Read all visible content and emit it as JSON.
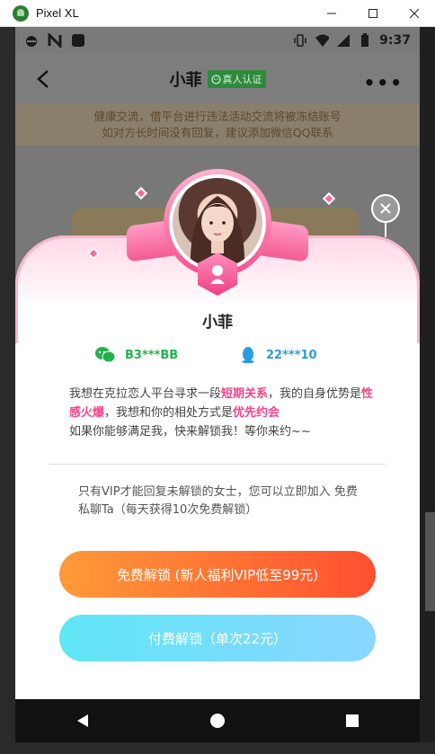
{
  "window": {
    "title": "Pixel XL"
  },
  "status_bar": {
    "time": "9:37"
  },
  "header": {
    "name": "小菲",
    "verified_label": "真人认证"
  },
  "notice": {
    "line1": "健康交流，借平台进行违法活动交流将被冻结账号",
    "line2": "如对方长时间没有回复，建议添加微信QQ联系"
  },
  "dialog": {
    "name": "小菲",
    "wechat": "B3***BB",
    "qq": "22***10",
    "intro": {
      "p1": "我想在克拉恋人平台寻求一段",
      "h1": "短期关系",
      "p2": "，我的自身优势是",
      "h2": "性感火爆",
      "p3": "，我想和你的相处方式是",
      "h3": "优先约会",
      "p4": "如果你能够满足我，快来解锁我！等你来约~~"
    },
    "vip_note": "只有VIP才能回复未解锁的女士，您可以立即加入 免费私聊Ta（每天获得10次免费解锁）",
    "free_unlock_label": "免费解锁 (新人福利VIP低至99元)",
    "paid_unlock_label": "付费解锁（单次22元）"
  },
  "colors": {
    "accent_pink": "#f5458a",
    "wechat_green": "#22b24c",
    "qq_blue": "#2a9be0",
    "free_btn": "#ff6a33",
    "paid_btn": "#6fe0f8"
  }
}
